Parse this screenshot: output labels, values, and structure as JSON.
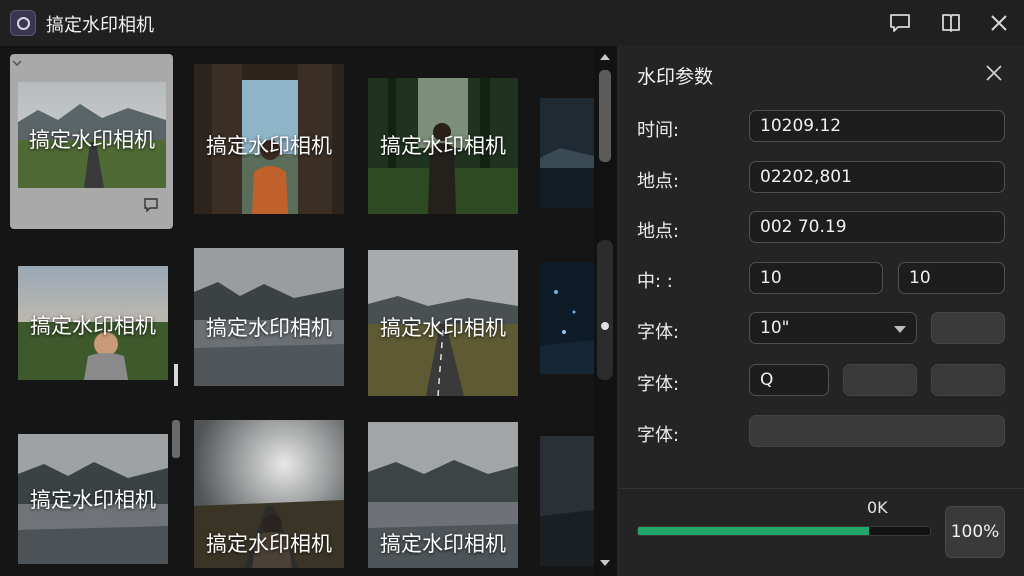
{
  "app": {
    "title": "搞定水印相机"
  },
  "titlebar": {
    "icons": [
      "feedback-icon",
      "bookmark-icon",
      "close-icon"
    ]
  },
  "gallery": {
    "watermark_text": "搞定水印相机",
    "thumbnails": [
      {
        "scene": "mountain-road"
      },
      {
        "scene": "person-doorway"
      },
      {
        "scene": "person-forest"
      },
      {
        "scene": "lake-night"
      },
      {
        "scene": "woman-portrait"
      },
      {
        "scene": "mountain-lake"
      },
      {
        "scene": "country-road"
      },
      {
        "scene": "blue-night"
      },
      {
        "scene": "mountain-lake"
      },
      {
        "scene": "person-road-sky"
      },
      {
        "scene": "mountain-lake"
      },
      {
        "scene": "lake-night"
      }
    ]
  },
  "panel": {
    "title": "水印参数",
    "rows": [
      {
        "label": "时间:",
        "value": "10209.12"
      },
      {
        "label": "地点:",
        "value": "02202,801"
      },
      {
        "label": "地点:",
        "value": "002 70.19"
      },
      {
        "label": "中:  :",
        "value_a": "10",
        "value_b": "10"
      },
      {
        "label": "字体:",
        "value": "10\""
      },
      {
        "label": "字体:",
        "value": "Q"
      },
      {
        "label": "字体:",
        "value": ""
      }
    ],
    "progress": {
      "label": "0K",
      "fraction": 0.79
    },
    "zoom_label": "100%"
  },
  "colors": {
    "accent": "#22a86a",
    "background": "#1a1a1a",
    "panel": "#242424"
  }
}
